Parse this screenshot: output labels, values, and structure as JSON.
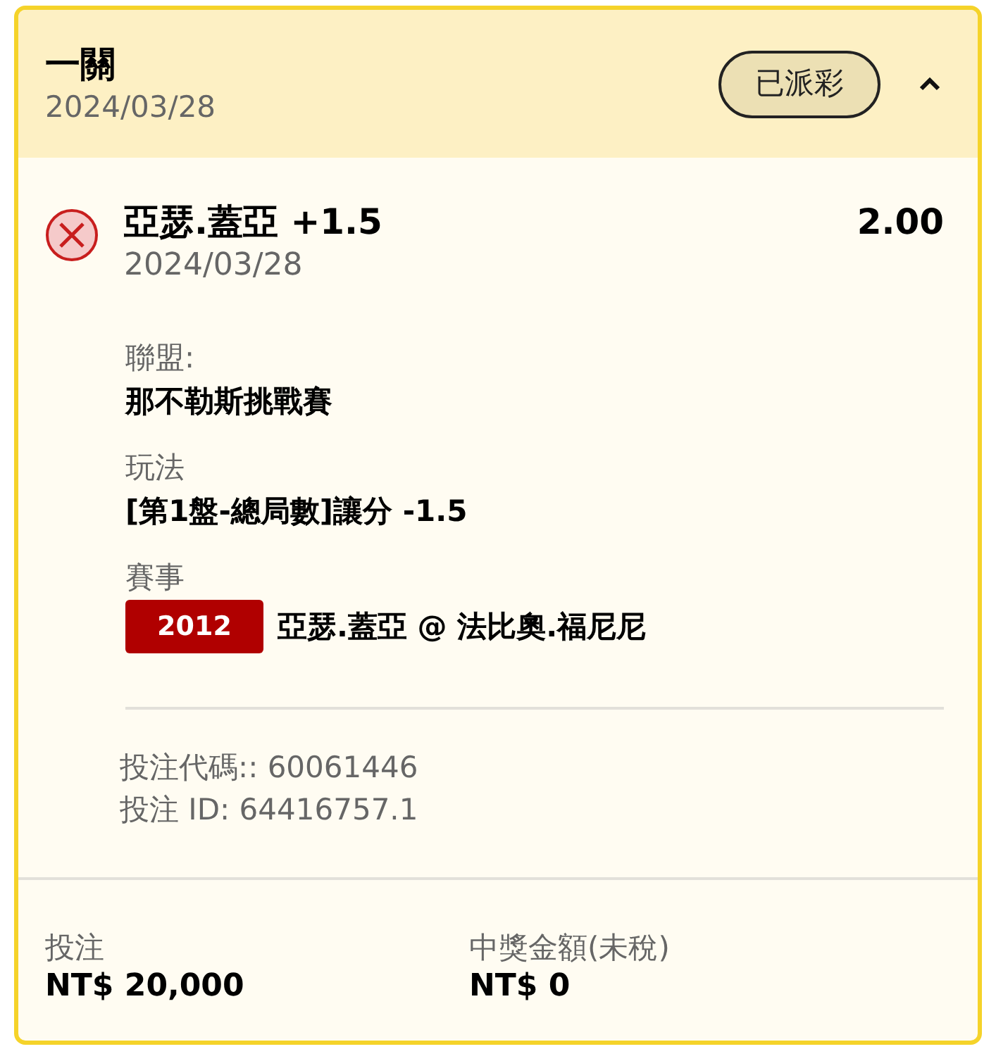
{
  "header": {
    "title": "一關",
    "date": "2024/03/28",
    "status_badge": "已派彩",
    "expanded": true
  },
  "selection": {
    "lost": true,
    "name": "亞瑟.蓋亞 +1.5",
    "date": "2024/03/28",
    "odds": "2.00",
    "details": [
      {
        "label": "聯盟:",
        "value": "那不勒斯挑戰賽"
      },
      {
        "label": "玩法",
        "value": "[第1盤-總局數]讓分 -1.5"
      },
      {
        "label": "賽事",
        "badge": "2012",
        "value": "亞瑟.蓋亞 @ 法比奧.福尼尼"
      }
    ]
  },
  "codes": [
    "投注代碼:: 60061446",
    "投注 ID: 64416757.1"
  ],
  "footer": [
    {
      "label": "投注",
      "value": "NT$ 20,000"
    },
    {
      "label": "中獎金額(未稅)",
      "value": "NT$ 0"
    }
  ]
}
